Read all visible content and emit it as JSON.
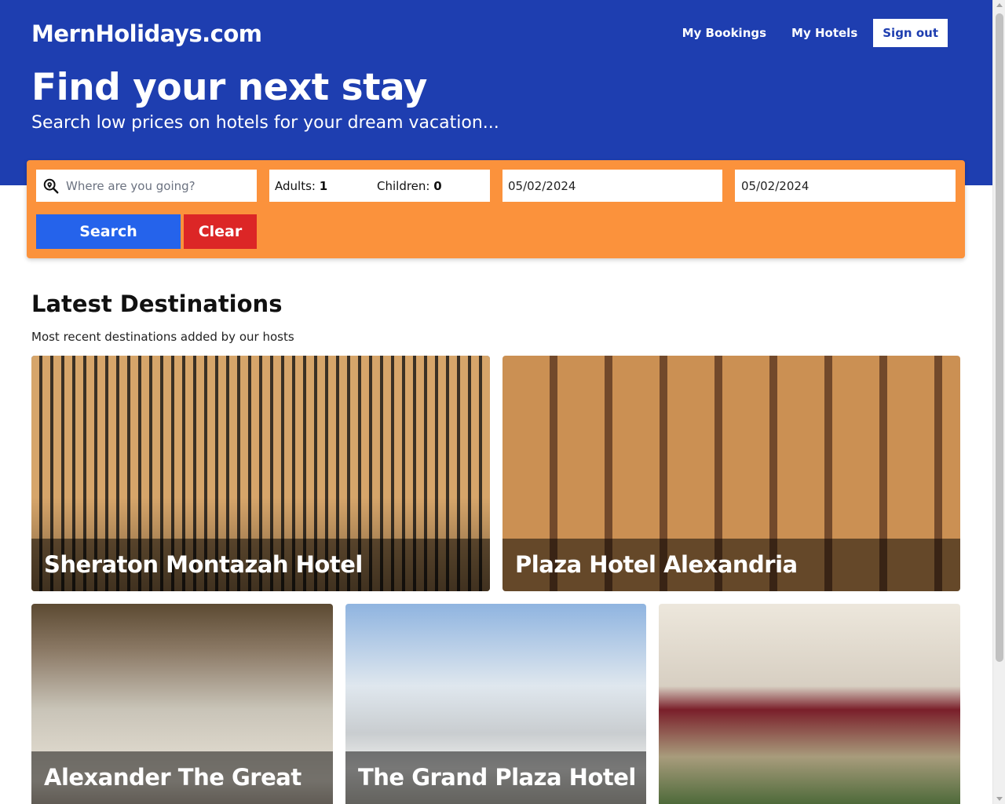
{
  "header": {
    "brand": "MernHolidays.com",
    "nav": {
      "my_bookings": "My Bookings",
      "my_hotels": "My Hotels",
      "sign_out": "Sign out"
    },
    "title": "Find your next stay",
    "subtitle": "Search low prices on hotels for your dream vacation..."
  },
  "search": {
    "destination_placeholder": "Where are you going?",
    "destination_icon": "search-location-icon",
    "adults_label": "Adults:",
    "adults_value": "1",
    "children_label": "Children:",
    "children_value": "0",
    "check_in": "05/02/2024",
    "check_out": "05/02/2024",
    "search_button": "Search",
    "clear_button": "Clear"
  },
  "destinations": {
    "title": "Latest Destinations",
    "subtitle": "Most recent destinations added by our hosts",
    "cards": [
      {
        "name": "Sheraton Montazah Hotel"
      },
      {
        "name": "Plaza Hotel Alexandria"
      },
      {
        "name": "Alexander The Great"
      },
      {
        "name": "The Grand Plaza Hotel"
      },
      {
        "name": ""
      }
    ]
  },
  "colors": {
    "header_bg": "#1e3eb0",
    "search_bar_bg": "#fb923c",
    "search_button": "#2563eb",
    "clear_button": "#dc2626"
  }
}
